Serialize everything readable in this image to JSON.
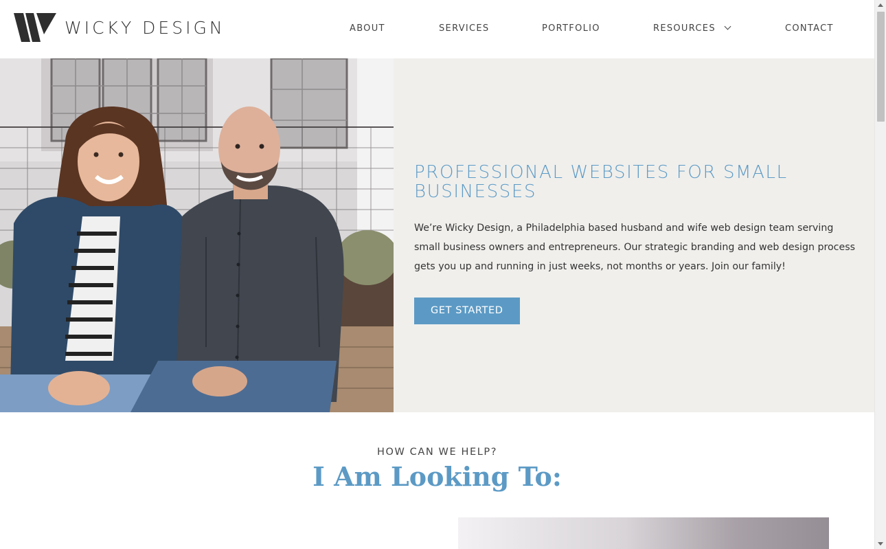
{
  "header": {
    "logo_text": "WICKY DESIGN",
    "nav": {
      "about": "ABOUT",
      "services": "SERVICES",
      "portfolio": "PORTFOLIO",
      "resources": "RESOURCES",
      "contact": "CONTACT"
    }
  },
  "hero": {
    "title": "PROFESSIONAL WEBSITES FOR SMALL BUSINESSES",
    "text": "We’re Wicky Design, a Philadelphia based husband and wife web design team serving small business owners and entrepreneurs. Our strategic branding and web design process gets you up and running in just weeks, not months or years. Join our family!",
    "cta_label": "GET STARTED",
    "photo_icon": "couple-photo"
  },
  "help": {
    "eyebrow": "HOW CAN WE HELP?",
    "title": "I Am Looking To:"
  },
  "colors": {
    "accent": "#5c9ac5",
    "hero_bg": "#f0efec",
    "text": "#333333"
  }
}
